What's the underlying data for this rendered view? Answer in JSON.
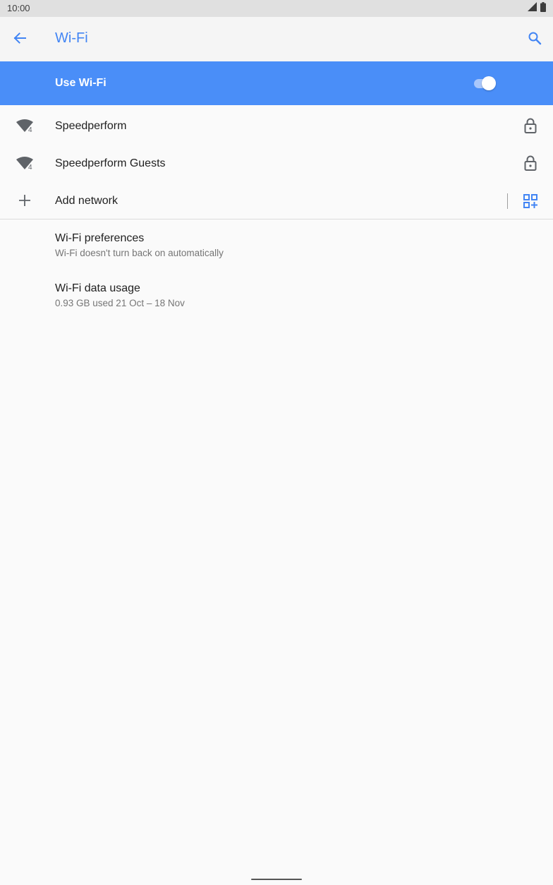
{
  "status_bar": {
    "time": "10:00",
    "icons": [
      "signal-icon",
      "battery-icon"
    ]
  },
  "app_bar": {
    "title": "Wi-Fi",
    "back_icon": "arrow-back-icon",
    "search_icon": "search-icon"
  },
  "master_switch": {
    "label": "Use Wi-Fi",
    "checked": true
  },
  "networks": [
    {
      "name": "Speedperform",
      "icon": "wifi-signal-icon",
      "badge": "4",
      "secured": true
    },
    {
      "name": "Speedperform Guests",
      "icon": "wifi-signal-icon",
      "badge": "4",
      "secured": true
    }
  ],
  "add_network": {
    "label": "Add network",
    "icon": "plus-icon",
    "qr_icon": "qr-code-scanner-icon"
  },
  "preferences": [
    {
      "title": "Wi-Fi preferences",
      "summary": "Wi-Fi doesn't turn back on automatically"
    },
    {
      "title": "Wi-Fi data usage",
      "summary": "0.93 GB used 21 Oct – 18 Nov"
    }
  ],
  "colors": {
    "accent": "#4285f4",
    "master_switch_bg": "#4a8ef8",
    "background": "#fafafa",
    "status_bar": "#e0e0e0",
    "app_bar": "#f5f5f5"
  }
}
